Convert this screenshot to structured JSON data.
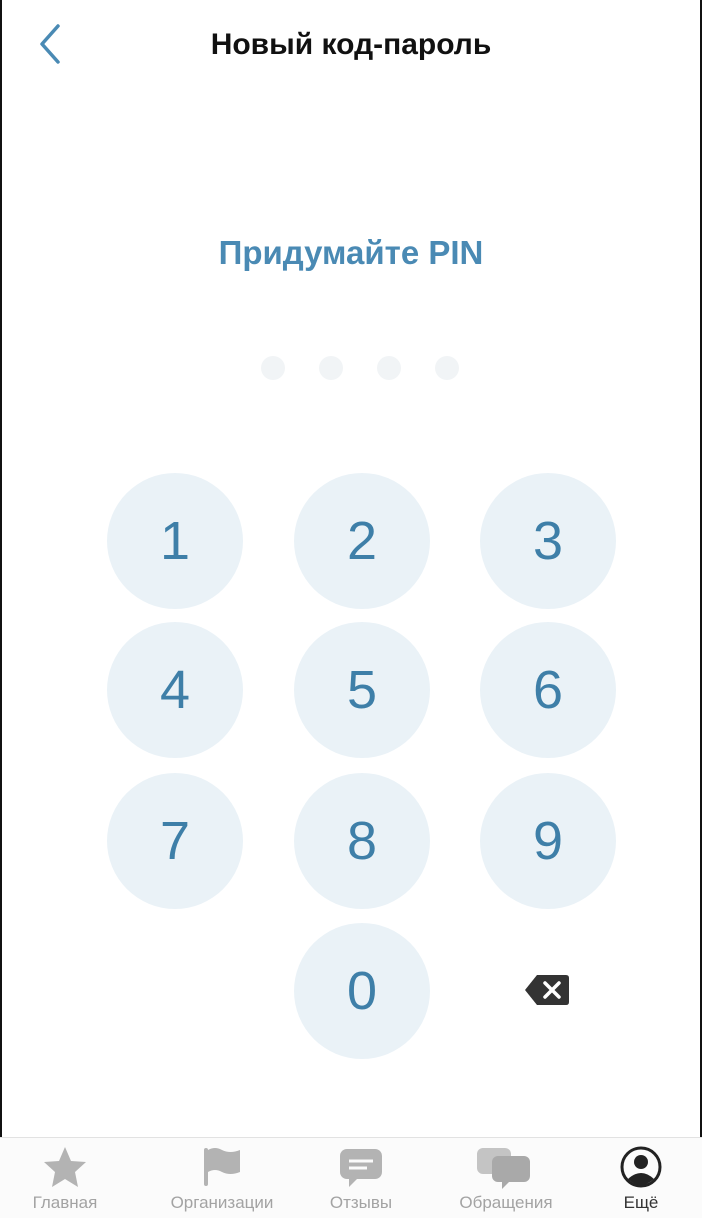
{
  "header": {
    "title": "Новый код-пароль",
    "back_icon": "chevron-left-icon"
  },
  "pin": {
    "prompt": "Придумайте PIN",
    "length": 4,
    "filled": 0
  },
  "keypad": {
    "keys": [
      "1",
      "2",
      "3",
      "4",
      "5",
      "6",
      "7",
      "8",
      "9",
      "0"
    ],
    "backspace_icon": "backspace-icon"
  },
  "tabbar": {
    "items": [
      {
        "label": "Главная",
        "icon": "star-icon"
      },
      {
        "label": "Организации",
        "icon": "flag-icon"
      },
      {
        "label": "Отзывы",
        "icon": "review-bubble-icon"
      },
      {
        "label": "Обращения",
        "icon": "chat-bubbles-icon"
      },
      {
        "label": "Ещё",
        "icon": "profile-icon"
      }
    ],
    "active_index": 4
  },
  "colors": {
    "accent": "#4a8ab4",
    "key_bg": "#eaf2f7",
    "key_text": "#3e7fa8",
    "dot_empty": "#f1f4f6",
    "tab_inactive": "#a3a3a3",
    "tab_active": "#333333"
  }
}
